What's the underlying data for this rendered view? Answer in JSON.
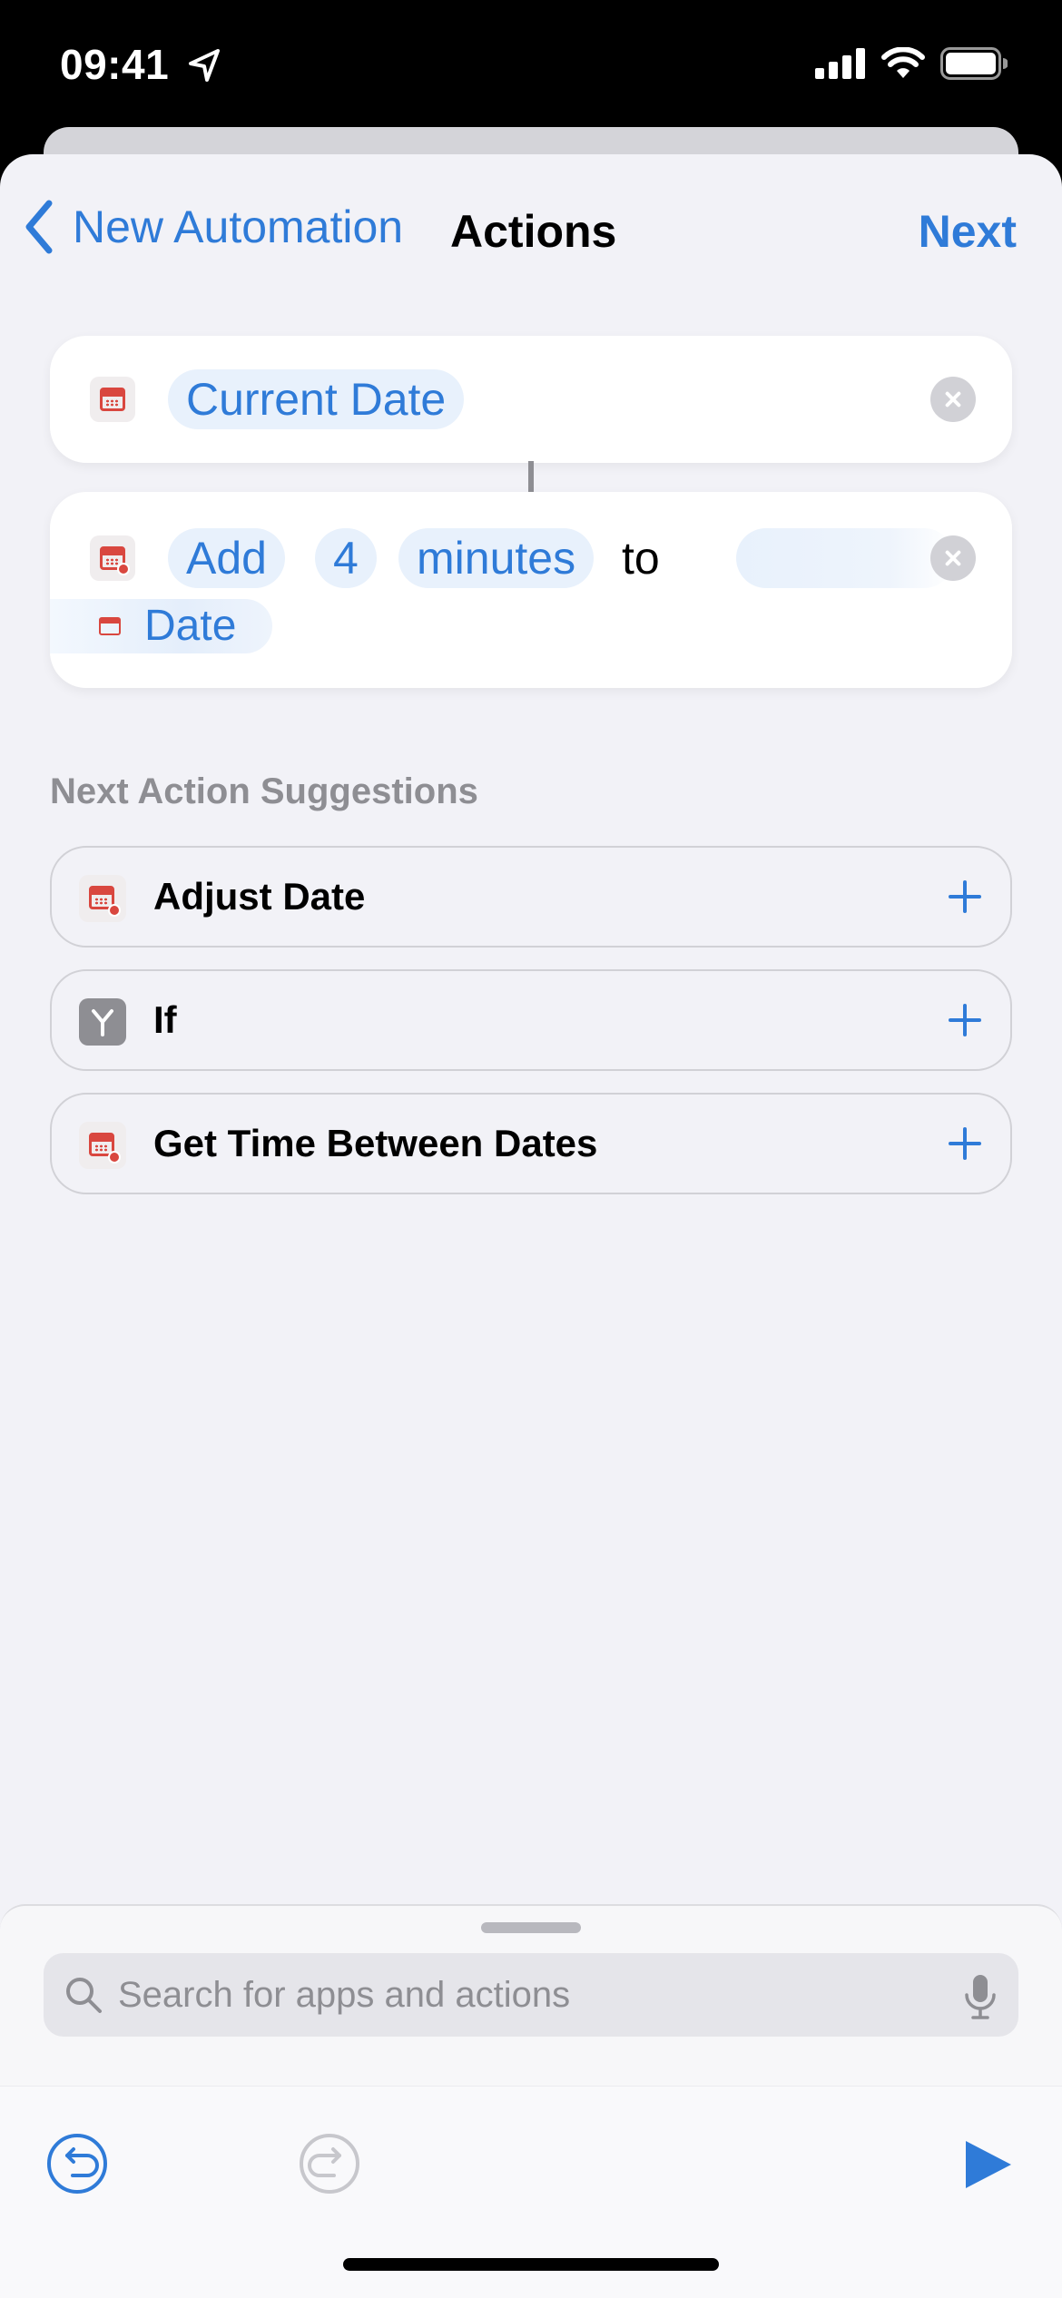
{
  "status_bar": {
    "time": "09:41"
  },
  "nav": {
    "back_label": "New Automation",
    "title": "Actions",
    "next_label": "Next"
  },
  "actions": [
    {
      "token": "Current Date"
    },
    {
      "verb": "Add",
      "amount": "4",
      "unit": "minutes",
      "connector": "to",
      "input_variable": "Date"
    }
  ],
  "suggestions": {
    "header": "Next Action Suggestions",
    "items": [
      {
        "label": "Adjust Date",
        "icon": "calendar-adjust-icon"
      },
      {
        "label": "If",
        "icon": "branch-icon"
      },
      {
        "label": "Get Time Between Dates",
        "icon": "calendar-adjust-icon"
      }
    ]
  },
  "search": {
    "placeholder": "Search for apps and actions"
  },
  "colors": {
    "accent": "#2f7bd8",
    "calendar_red": "#d9473f",
    "background": "#f2f2f7"
  }
}
